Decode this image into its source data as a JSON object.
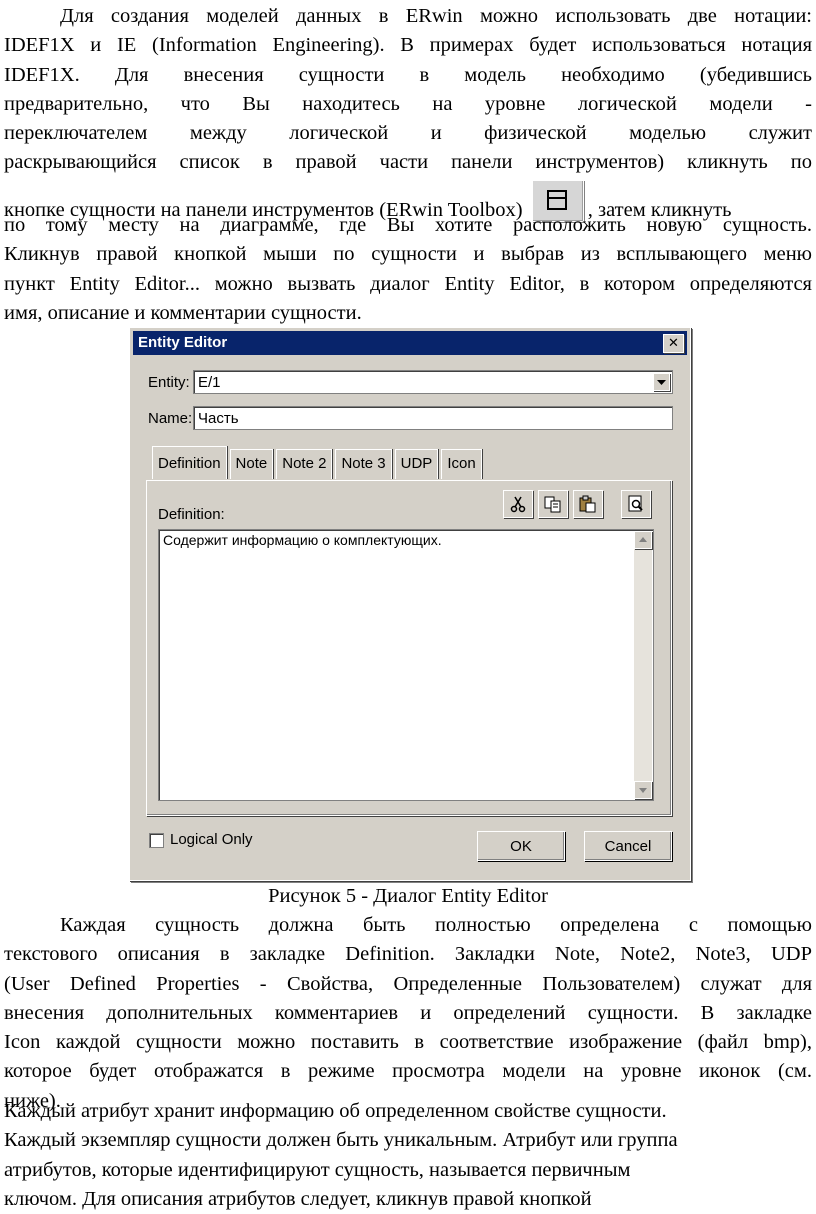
{
  "paragraph1": {
    "lines": [
      "Для создания моделей данных в ERwin можно использовать две нотации:",
      "IDEF1X и IE (Information Engineering). В примерах будет использоваться нотация",
      "IDEF1X. Для внесения сущности в модель необходимо (убедившись",
      "предварительно, что Вы находитесь на уровне логической модели -",
      "переключателем между логической и физической моделью служит",
      "раскрывающийся список в правой части панели инструментов) кликнуть по"
    ],
    "line7_before": "кнопке сущности на панели инструментов (ERwin Toolbox)",
    "line7_after": ", затем кликнуть",
    "lines_after": [
      "по тому месту на диаграмме, где Вы хотите расположить новую сущность.",
      "Кликнув правой кнопкой мыши по сущности и выбрав из всплывающего меню",
      "пункт Entity Editor... можно вызвать диалог Entity Editor, в котором определяются",
      "имя, описание и комментарии сущности."
    ]
  },
  "toolbar_icon": "entity-icon",
  "dialog": {
    "title": "Entity Editor",
    "close": "✕",
    "entity_label": "Entity:",
    "entity_value": "E/1",
    "name_label": "Name:",
    "name_value": "Часть",
    "tabs": [
      "Definition",
      "Note",
      "Note 2",
      "Note 3",
      "UDP",
      "Icon"
    ],
    "definition_label": "Definition:",
    "definition_text": "Содержит информацию о комплектующих.",
    "tool_icons": [
      "cut-icon",
      "copy-icon",
      "paste-icon",
      "preview-icon"
    ],
    "logical_only": "Logical Only",
    "ok": "OK",
    "cancel": "Cancel"
  },
  "caption": "Рисунок 5 - Диалог Entity Editor",
  "paragraph2": {
    "lines": [
      "Каждая сущность должна быть полностью определена с помощью",
      "текстового описания в закладке Definition. Закладки Note, Note2, Note3, UDP",
      "(User Defined Properties - Свойства, Определенные Пользователем) служат для",
      "внесения дополнительных комментариев и определений сущности. В закладке",
      "Icon каждой сущности можно поставить в соответствие изображение (файл bmp),",
      "которое будет отображатся в режиме просмотра модели на уровне иконок (см."
    ],
    "last": "ниже)."
  },
  "paragraph3": [
    "Каждый атрибут хранит информацию об определенном свойстве сущности.",
    "Каждый экземпляр сущности должен быть уникальным. Атрибут или группа",
    "атрибутов, которые идентифицируют сущность, называется первичным",
    "ключом. Для описания атрибутов следует, кликнув правой кнопкой"
  ]
}
